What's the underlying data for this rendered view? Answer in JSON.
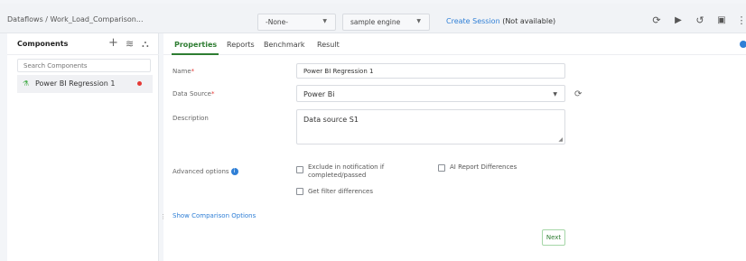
{
  "topbar": {
    "breadcrumb": "Dataflows / Work_Load_Comparison...",
    "select_none": "-None-",
    "select_engine": "sample engine",
    "create_session_link": "Create Session",
    "create_session_status": "(Not available)"
  },
  "left_panel": {
    "title": "Components",
    "search_placeholder": "Search Components",
    "items": [
      {
        "label": "Power BI Regression 1",
        "status_color": "#e53935"
      }
    ]
  },
  "tabs": [
    {
      "label": "Properties",
      "active": true
    },
    {
      "label": "Reports",
      "active": false
    },
    {
      "label": "Benchmark",
      "active": false
    },
    {
      "label": "Result",
      "active": false
    }
  ],
  "form": {
    "name_label": "Name",
    "name_value": "Power BI Regression 1",
    "datasource_label": "Data Source",
    "datasource_value": "Power Bi",
    "description_label": "Description",
    "description_value": "Data source S1",
    "required_marker": "*",
    "advanced_label": "Advanced options",
    "opt_exclude": "Exclude in notification if completed/passed",
    "opt_ai_report": "AI Report Differences",
    "opt_filter": "Get filter differences",
    "show_comparison": "Show Comparison Options",
    "next_button": "Next"
  },
  "colors": {
    "accent_green": "#2e7d32",
    "link_blue": "#2f7fd6",
    "error_red": "#e53935"
  }
}
